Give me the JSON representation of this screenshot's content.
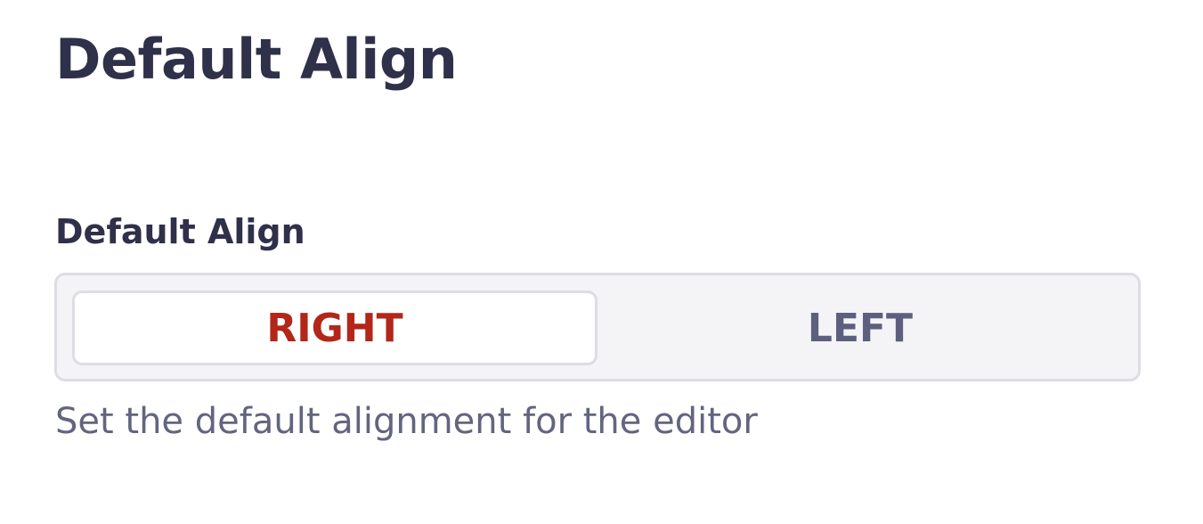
{
  "page": {
    "title": "Default Align"
  },
  "field": {
    "label": "Default Align",
    "options": [
      {
        "label": "RIGHT",
        "selected": true
      },
      {
        "label": "LEFT",
        "selected": false
      }
    ],
    "helper_text": "Set the default alignment for the editor"
  },
  "colors": {
    "heading": "#2f3049",
    "selected_text": "#b3261a",
    "unselected_text": "#5d5f7e",
    "helper_text": "#63657f",
    "control_background": "#f4f4f7",
    "control_border": "#dddde3"
  }
}
